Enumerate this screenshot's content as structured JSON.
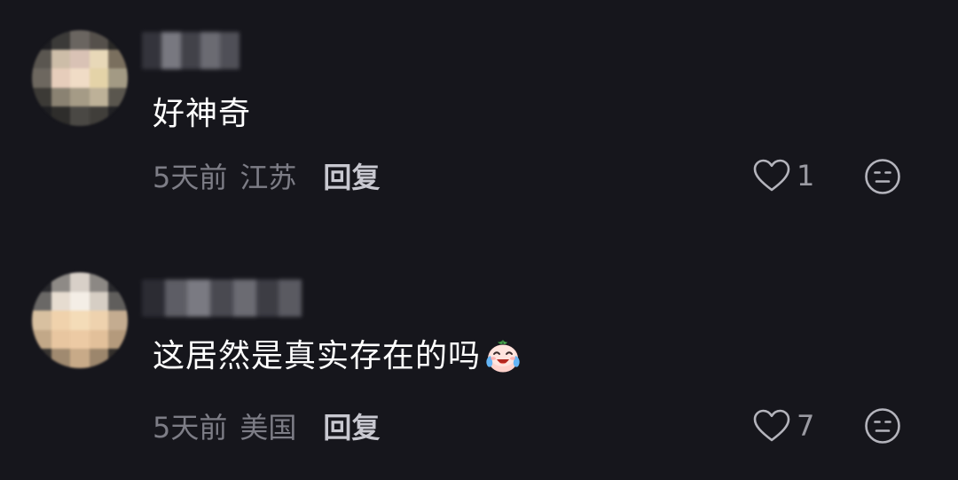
{
  "comments": [
    {
      "text": "好神奇",
      "time": "5天前",
      "location": "江苏",
      "reply_label": "回复",
      "like_count": "1",
      "has_emoji": false
    },
    {
      "text": "这居然是真实存在的吗",
      "time": "5天前",
      "location": "美国",
      "reply_label": "回复",
      "like_count": "7",
      "has_emoji": true,
      "emoji": "crying-laughing-peach-emoji"
    }
  ],
  "icons": {
    "like": "heart-outline-icon",
    "dislike": "neutral-face-icon"
  },
  "colors": {
    "background": "#16161c",
    "text": "#ffffff",
    "meta": "#7d7d86",
    "reply": "#c8c8d0"
  }
}
